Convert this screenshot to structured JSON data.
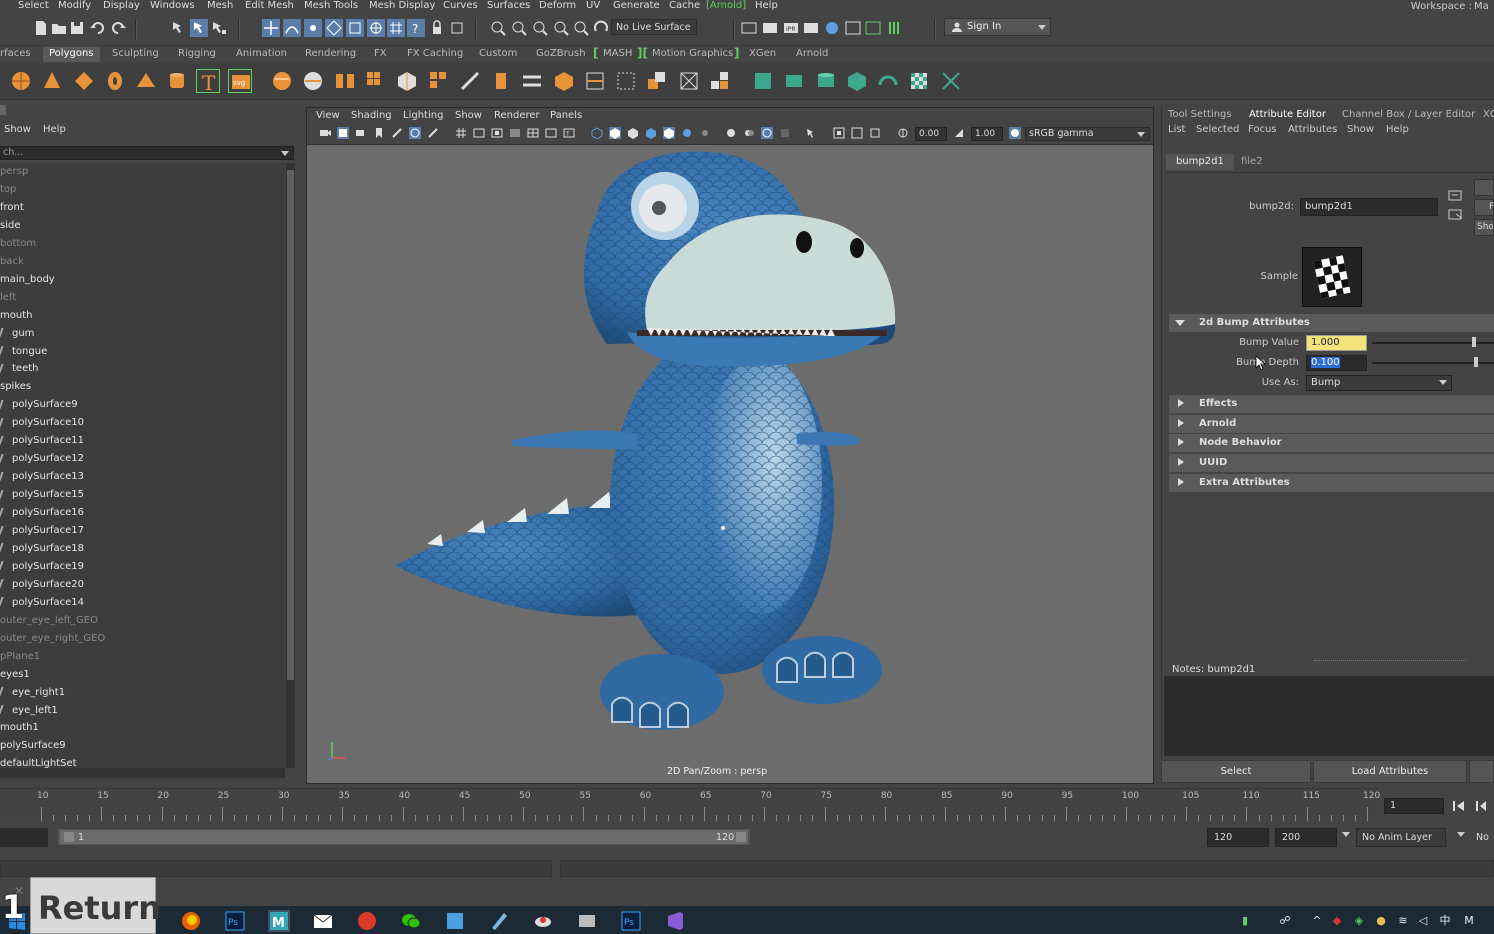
{
  "menubar": {
    "items": [
      "Select",
      "Modify",
      "Display",
      "Windows",
      "Mesh",
      "Edit Mesh",
      "Mesh Tools",
      "Mesh Display",
      "Curves",
      "Surfaces",
      "Deform",
      "UV",
      "Generate",
      "Cache",
      "Arnold",
      "Help"
    ],
    "workspace_label": "Workspace :",
    "workspace_value": "Ma"
  },
  "statusline": {
    "live_surface": "No Live Surface",
    "sign_in": "Sign In"
  },
  "shelf_tabs": [
    "rfaces",
    "Polygons",
    "Sculpting",
    "Rigging",
    "Animation",
    "Rendering",
    "FX",
    "FX Caching",
    "Custom",
    "GoZBrush",
    "MASH",
    "Motion Graphics",
    "XGen",
    "Arnold"
  ],
  "active_shelf_tab": "Polygons",
  "outliner": {
    "menu": [
      "Show",
      "Help"
    ],
    "search_placeholder": "ch...",
    "items": [
      {
        "label": "persp",
        "dim": true
      },
      {
        "label": "top",
        "dim": true
      },
      {
        "label": "front",
        "dim": false
      },
      {
        "label": "side",
        "dim": false
      },
      {
        "label": "bottom",
        "dim": true
      },
      {
        "label": "back",
        "dim": true
      },
      {
        "label": "main_body",
        "dim": false
      },
      {
        "label": "left",
        "dim": true
      },
      {
        "label": "mouth",
        "dim": false
      },
      {
        "label": "gum",
        "dim": false,
        "mark": true
      },
      {
        "label": "tongue",
        "dim": false,
        "mark": true
      },
      {
        "label": "teeth",
        "dim": false,
        "mark": true
      },
      {
        "label": "spikes",
        "dim": false
      },
      {
        "label": "polySurface9",
        "dim": false,
        "mark": true
      },
      {
        "label": "polySurface10",
        "dim": false,
        "mark": true
      },
      {
        "label": "polySurface11",
        "dim": false,
        "mark": true
      },
      {
        "label": "polySurface12",
        "dim": false,
        "mark": true
      },
      {
        "label": "polySurface13",
        "dim": false,
        "mark": true
      },
      {
        "label": "polySurface15",
        "dim": false,
        "mark": true
      },
      {
        "label": "polySurface16",
        "dim": false,
        "mark": true
      },
      {
        "label": "polySurface17",
        "dim": false,
        "mark": true
      },
      {
        "label": "polySurface18",
        "dim": false,
        "mark": true
      },
      {
        "label": "polySurface19",
        "dim": false,
        "mark": true
      },
      {
        "label": "polySurface20",
        "dim": false,
        "mark": true
      },
      {
        "label": "polySurface14",
        "dim": false,
        "mark": true
      },
      {
        "label": "outer_eye_left_GEO",
        "dim": true
      },
      {
        "label": "outer_eye_right_GEO",
        "dim": true
      },
      {
        "label": "pPlane1",
        "dim": true
      },
      {
        "label": "eyes1",
        "dim": false
      },
      {
        "label": "eye_right1",
        "dim": false,
        "mark": true
      },
      {
        "label": "eye_left1",
        "dim": false,
        "mark": true
      },
      {
        "label": "mouth1",
        "dim": false
      },
      {
        "label": "polySurface9",
        "dim": false
      },
      {
        "label": "defaultLightSet",
        "dim": false
      }
    ]
  },
  "viewport": {
    "menu": [
      "View",
      "Shading",
      "Lighting",
      "Show",
      "Renderer",
      "Panels"
    ],
    "exposure": "0.00",
    "gamma": "1.00",
    "color_space": "sRGB gamma",
    "hud_label": "2D Pan/Zoom : persp"
  },
  "attribute_editor": {
    "tabs": [
      "Tool Settings",
      "Attribute Editor",
      "Channel Box / Layer Editor",
      "XG"
    ],
    "active_tab": "Attribute Editor",
    "menu": [
      "List",
      "Selected",
      "Focus",
      "Attributes",
      "Show",
      "Help"
    ],
    "node_tabs": [
      "bump2d1",
      "file2"
    ],
    "node_type_label": "bump2d:",
    "node_name": "bump2d1",
    "side_buttons": [
      "F",
      "Sho"
    ],
    "sample_label": "Sample",
    "section_open": "2d Bump Attributes",
    "bump_value_label": "Bump Value",
    "bump_value": "1.000",
    "bump_depth_label": "Bump Depth",
    "bump_depth": "0.100",
    "use_as_label": "Use As:",
    "use_as_value": "Bump",
    "collapsed_sections": [
      "Effects",
      "Arnold",
      "Node Behavior",
      "UUID",
      "Extra Attributes"
    ],
    "notes_label": "Notes:  bump2d1",
    "buttons": [
      "Select",
      "Load Attributes"
    ]
  },
  "timeslider": {
    "ticks": [
      "10",
      "15",
      "20",
      "25",
      "30",
      "35",
      "40",
      "45",
      "50",
      "55",
      "60",
      "65",
      "70",
      "75",
      "80",
      "85",
      "90",
      "95",
      "100",
      "105",
      "110",
      "115",
      "120"
    ],
    "current_frame": "1"
  },
  "range": {
    "start_inner": "1",
    "end_inner": "120",
    "end_field": "120",
    "max_field": "200",
    "anim_layer": "No Anim Layer",
    "char_set": "No"
  },
  "overlay": {
    "return_number": "1",
    "return_label": "Return"
  },
  "colors": {
    "panel": "#444444",
    "viewport_bg": "#6c6c6c",
    "dino_body": "#2f6aa3",
    "dino_belly": "#c9dbd6",
    "highlight_field": "#f2e37a",
    "select_blue": "#2e6fd8",
    "arnold_green": "#5dd05d",
    "taskbar": "#1c2a36"
  }
}
